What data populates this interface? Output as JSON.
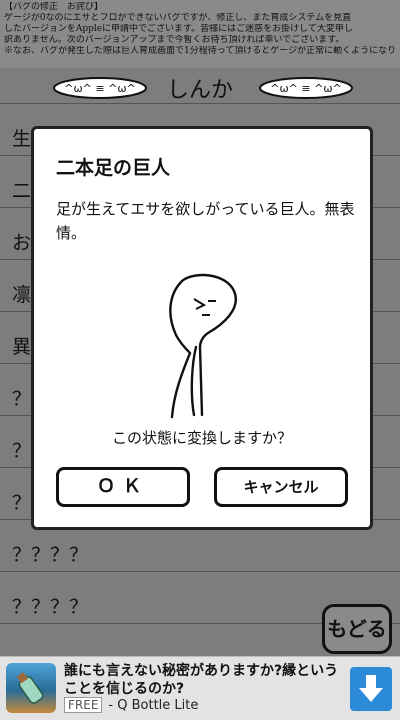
{
  "notice": {
    "lines": [
      "【バグの修正　お詫び】",
      "ゲージが0なのにエサとフロができないバグですが、修正し、また育成システムを見直",
      "したバージョンをAppleに申請中でございます。皆様にはご迷惑をお掛けして大変申し",
      "訳ありません。次のバージョンアップまで今暫くお待ち頂ければ幸いでございます。",
      "※なお、バグが発生した際は巨人育成画面で1分程待って頂けるとゲージが正常に動くようになります。"
    ]
  },
  "header": {
    "title": "しんか",
    "deco_text": "^ω^ ≡ ^ω^"
  },
  "list": {
    "rows": [
      "生",
      "二",
      "お",
      "凛",
      "異",
      "？",
      "？",
      "？",
      "？？？？",
      "？？？？"
    ]
  },
  "back_button": {
    "label": "もどる"
  },
  "dialog": {
    "title": "二本足の巨人",
    "description": "足が生えてエサを欲しがっている巨人。無表情。",
    "question": "この状態に変換しますか？",
    "ok_label": "ＯＫ",
    "cancel_label": "キャンセル"
  },
  "ad": {
    "text": "誰にも言えない秘密がありますか?縁ということを信じるのか?",
    "free_label": "FREE",
    "app_name": "- Q Bottle Lite",
    "download_icon": "download-arrow-icon"
  }
}
